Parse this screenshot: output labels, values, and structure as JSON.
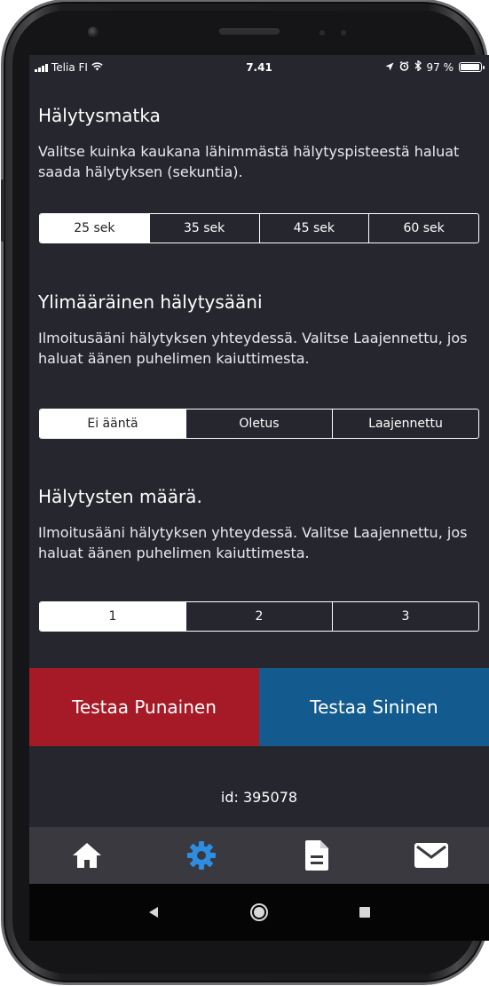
{
  "status_bar": {
    "carrier": "Telia FI",
    "time": "7.41",
    "battery_text": "97 %",
    "battery_level": 0.97
  },
  "alarm_distance": {
    "title": "Hälytysmatka",
    "description": "Valitse kuinka kaukana lähimmästä hälytyspisteestä haluat saada hälytyksen (sekuntia).",
    "options": [
      "25 sek",
      "35 sek",
      "45 sek",
      "60 sek"
    ],
    "selected": "25 sek"
  },
  "extra_sound": {
    "title": "Ylimääräinen hälytysääni",
    "description": "Ilmoitusääni hälytyksen yhteydessä. Valitse Laajennettu, jos haluat äänen puhelimen kaiuttimesta.",
    "options": [
      "Ei ääntä",
      "Oletus",
      "Laajennettu"
    ],
    "selected": "Ei ääntä"
  },
  "alarm_count": {
    "title": "Hälytysten määrä.",
    "description": "Ilmoitusääni hälytyksen yhteydessä. Valitse Laajennettu, jos haluat äänen puhelimen kaiuttimesta.",
    "options": [
      "1",
      "2",
      "3"
    ],
    "selected": "1"
  },
  "test_buttons": {
    "red_label": "Testaa Punainen",
    "blue_label": "Testaa Sininen",
    "red_color": "#a51a26",
    "blue_color": "#135a8e"
  },
  "device_id": "id: 395078",
  "tabbar": {
    "items": [
      {
        "icon": "home-icon",
        "active": false
      },
      {
        "icon": "gear-icon",
        "active": true
      },
      {
        "icon": "document-icon",
        "active": false
      },
      {
        "icon": "mail-icon",
        "active": false
      }
    ],
    "active_color": "#2d8de0",
    "inactive_color": "#ffffff"
  },
  "android_nav": {
    "items": [
      "back-icon",
      "home-circle-icon",
      "recents-icon"
    ]
  },
  "colors": {
    "screen_bg": "#26262e",
    "tabbar_bg": "#3b3940"
  }
}
